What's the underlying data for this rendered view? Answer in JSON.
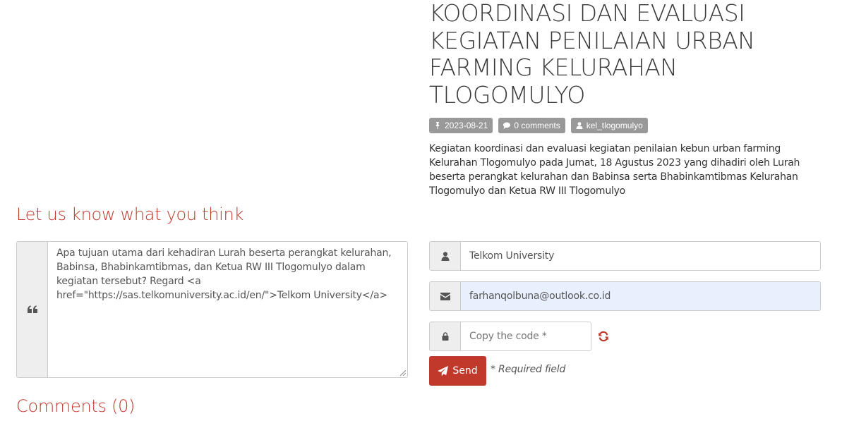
{
  "article": {
    "title": "KOORDINASI DAN EVALUASI KEGIATAN PENILAIAN URBAN FARMING KELURAHAN TLOGOMULYO",
    "date": "2023-08-21",
    "comments_count": "0 comments",
    "author": "kel_tlogomulyo",
    "body": "Kegiatan koordinasi dan evaluasi kegiatan penilaian kebun urban farming Kelurahan Tlogomulyo pada Jumat, 18 Agustus 2023 yang dihadiri oleh Lurah beserta perangkat kelurahan dan Babinsa serta Bhabinkamtibmas Kelurahan Tlogomulyo dan Ketua RW III Tlogomulyo"
  },
  "feedback": {
    "heading": "Let us know what you think",
    "comment_value": "Apa tujuan utama dari kehadiran Lurah beserta perangkat kelurahan, Babinsa, Bhabinkamtibmas, dan Ketua RW III Tlogomulyo dalam kegiatan tersebut? Regard <a href=\"https://sas.telkomuniversity.ac.id/en/\">Telkom University</a>",
    "name_value": "Telkom University",
    "email_value": "farhanqolbuna@outlook.co.id",
    "code_placeholder": "Copy the code *",
    "send_label": "Send",
    "required_note": "* Required field"
  },
  "comments": {
    "heading": "Comments (0)"
  },
  "colors": {
    "accent": "#c0392b",
    "label_bg": "#999999",
    "autofill_bg": "#e8f0fe"
  },
  "icons": {
    "date": "pin-icon",
    "comments": "comment-icon",
    "author": "user-icon",
    "comment_box": "quote-icon",
    "name": "user-icon",
    "email": "envelope-icon",
    "code": "lock-icon",
    "refresh": "refresh-icon",
    "send": "paper-plane-icon"
  }
}
